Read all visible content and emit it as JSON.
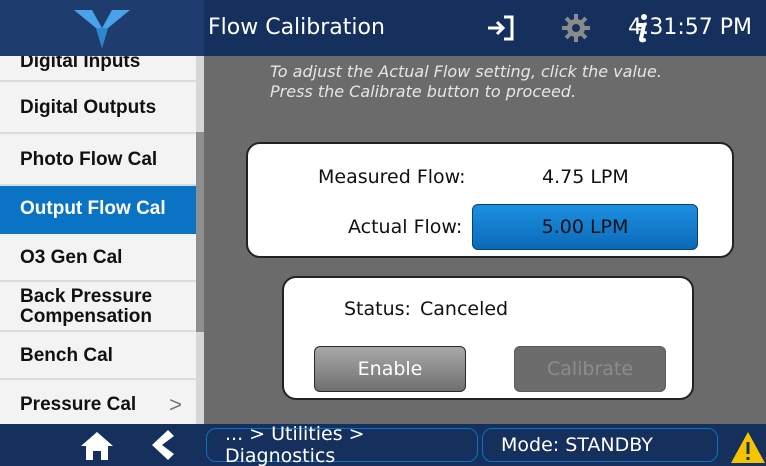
{
  "header": {
    "title": "Flow Calibration",
    "time": "4:31:57 PM",
    "icons": [
      "logo-icon",
      "exit-icon",
      "gear-icon",
      "info-icon"
    ]
  },
  "sidebar": {
    "items": [
      {
        "label": "Digital Inputs",
        "active": false
      },
      {
        "label": "Digital Outputs",
        "active": false
      },
      {
        "label": "Photo Flow Cal",
        "active": false
      },
      {
        "label": "Output Flow Cal",
        "active": true
      },
      {
        "label": "O3 Gen Cal",
        "active": false
      },
      {
        "label_line1": "Back Pressure",
        "label_line2": "Compensation",
        "active": false
      },
      {
        "label": "Bench Cal",
        "active": false
      },
      {
        "label": "Pressure Cal",
        "active": false,
        "chevron": ">"
      }
    ]
  },
  "main": {
    "instruction_line1": "To adjust the Actual Flow setting, click the value.",
    "instruction_line2": "Press the Calibrate button to proceed.",
    "measured_label": "Measured Flow:",
    "measured_value": "4.75 LPM",
    "actual_label": "Actual Flow:",
    "actual_value": "5.00 LPM",
    "status_label": "Status:",
    "status_value": "Canceled",
    "enable_label": "Enable",
    "calibrate_label": "Calibrate"
  },
  "footer": {
    "breadcrumb": "... > Utilities > Diagnostics",
    "mode": "Mode: STANDBY",
    "icons": [
      "home-icon",
      "back-icon",
      "warning-icon"
    ]
  },
  "colors": {
    "header_bg": "#15305c",
    "accent": "#0b73c4",
    "panel_bg": "#ffffff",
    "main_bg": "#6b6b6b",
    "warning": "#f5c400"
  }
}
